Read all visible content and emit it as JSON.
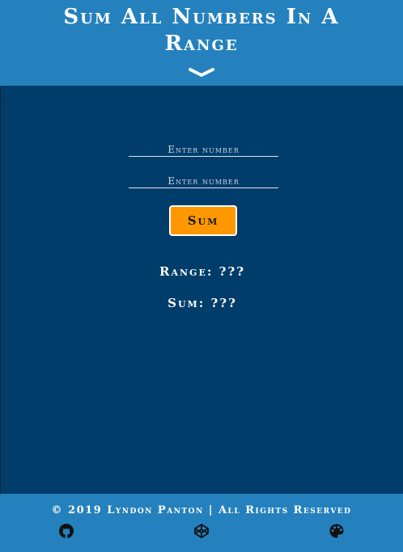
{
  "header": {
    "title_line1": "Sum All Numbers In A",
    "title_line2": "Range",
    "chevron_icon": "chevron-down-icon"
  },
  "form": {
    "input1_placeholder": "Enter number",
    "input1_value": "",
    "input2_placeholder": "Enter number",
    "input2_value": "",
    "sum_button_label": "Sum"
  },
  "results": {
    "range_label": "Range:",
    "range_value": "???",
    "sum_label": "Sum:",
    "sum_value": "???"
  },
  "footer": {
    "copyright": "© 2019 Lyndon Panton | All Rights Reserved",
    "links": [
      {
        "icon": "github-icon"
      },
      {
        "icon": "codepen-icon"
      },
      {
        "icon": "palette-icon"
      }
    ]
  },
  "colors": {
    "header_bg": "#2581bd",
    "main_bg": "#003d6b",
    "button_bg": "#ff9800",
    "text": "#ffffff"
  }
}
